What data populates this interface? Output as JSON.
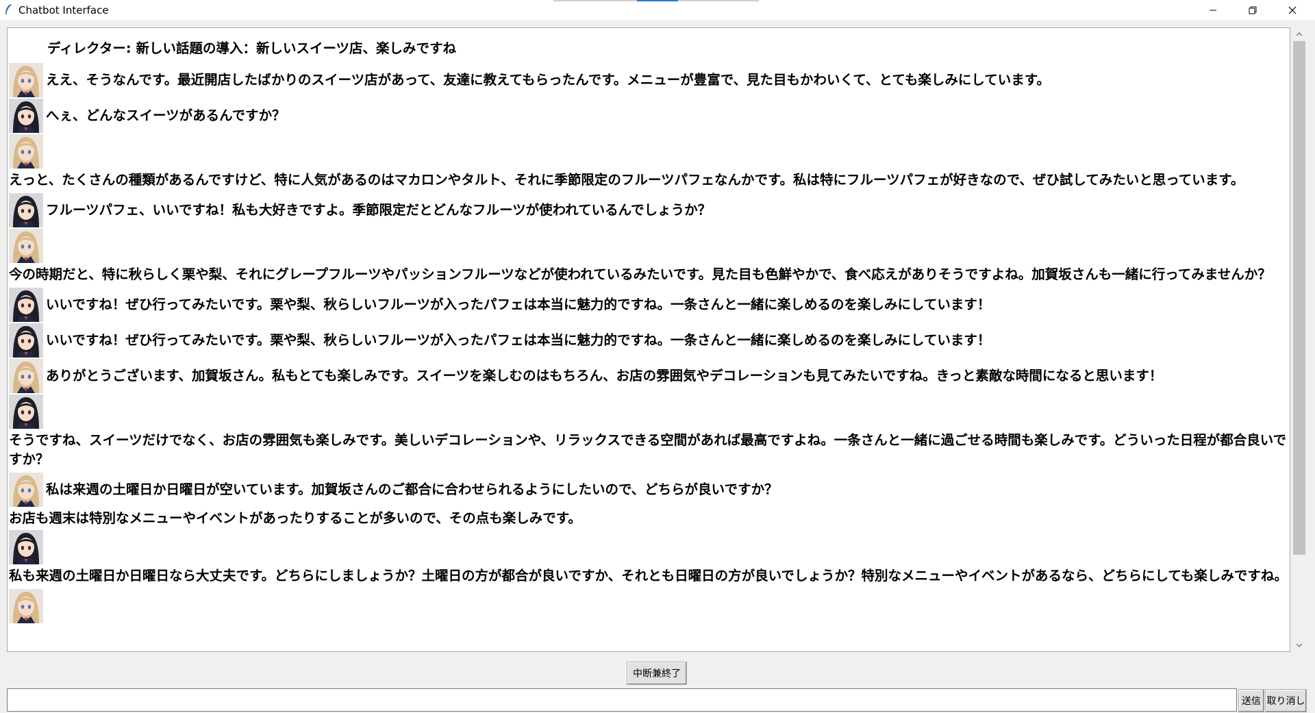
{
  "window": {
    "title": "Chatbot Interface"
  },
  "colors": {
    "window_bg": "#f0f0f0",
    "chat_bg": "#ffffff",
    "text": "#000000",
    "scroll_thumb": "#c1c1c1",
    "hair_blonde": "#d9b98a",
    "hair_black": "#1e1e28"
  },
  "icons": {
    "app": "feather-icon",
    "minimize": "minimize-icon",
    "maximize": "restore-icon",
    "close": "close-icon",
    "scroll_up": "chevron-up-icon",
    "scroll_down": "chevron-down-icon",
    "avatar_a": "avatar-blonde-girl",
    "avatar_b": "avatar-black-hair-girl"
  },
  "chat": {
    "director": "ディレクター: 新しい話題の導入：新しいスイーツ店、楽しみですね",
    "messages": [
      {
        "speaker": "a",
        "layout": "inline",
        "text": "ええ、そうなんです。最近開店したばかりのスイーツ店があって、友達に教えてもらったんです。メニューが豊富で、見た目もかわいくて、とても楽しみにしています。"
      },
      {
        "speaker": "b",
        "layout": "inline",
        "text": "へぇ、どんなスイーツがあるんですか？"
      },
      {
        "speaker": "a",
        "layout": "block",
        "text": "えっと、たくさんの種類があるんですけど、特に人気があるのはマカロンやタルト、それに季節限定のフルーツパフェなんかです。私は特にフルーツパフェが好きなので、ぜひ試してみたいと思っています。"
      },
      {
        "speaker": "b",
        "layout": "inline",
        "text": "フルーツパフェ、いいですね！私も大好きですよ。季節限定だとどんなフルーツが使われているんでしょうか？"
      },
      {
        "speaker": "a",
        "layout": "block",
        "text": "今の時期だと、特に秋らしく栗や梨、それにグレープフルーツやパッションフルーツなどが使われているみたいです。見た目も色鮮やかで、食べ応えがありそうですよね。加賀坂さんも一緒に行ってみませんか？"
      },
      {
        "speaker": "b",
        "layout": "inline",
        "text": "いいですね！ぜひ行ってみたいです。栗や梨、秋らしいフルーツが入ったパフェは本当に魅力的ですね。一条さんと一緒に楽しめるのを楽しみにしています！"
      },
      {
        "speaker": "b",
        "layout": "inline",
        "text": "いいですね！ぜひ行ってみたいです。栗や梨、秋らしいフルーツが入ったパフェは本当に魅力的ですね。一条さんと一緒に楽しめるのを楽しみにしています！"
      },
      {
        "speaker": "a",
        "layout": "inline",
        "text": "ありがとうございます、加賀坂さん。私もとても楽しみです。スイーツを楽しむのはもちろん、お店の雰囲気やデコレーションも見てみたいですね。きっと素敵な時間になると思います！"
      },
      {
        "speaker": "b",
        "layout": "block",
        "text": "そうですね、スイーツだけでなく、お店の雰囲気も楽しみです。美しいデコレーションや、リラックスできる空間があれば最高ですよね。一条さんと一緒に過ごせる時間も楽しみです。どういった日程が都合良いですか？"
      },
      {
        "speaker": "a",
        "layout": "inline",
        "text": "私は来週の土曜日か日曜日が空いています。加賀坂さんのご都合に合わせられるようにしたいので、どちらが良いですか？",
        "continuation": "お店も週末は特別なメニューやイベントがあったりすることが多いので、その点も楽しみです。"
      },
      {
        "speaker": "b",
        "layout": "block",
        "text": "私も来週の土曜日か日曜日なら大丈夫です。どちらにしましょうか？土曜日の方が都合が良いですか、それとも日曜日の方が良いでしょうか？特別なメニューやイベントがあるなら、どちらにしても楽しみですね。"
      },
      {
        "speaker": "a",
        "layout": "avatar-only",
        "text": ""
      }
    ]
  },
  "controls": {
    "stop_label": "中断兼終了",
    "input_value": "",
    "send_label": "送信",
    "cancel_label": "取り消し"
  }
}
